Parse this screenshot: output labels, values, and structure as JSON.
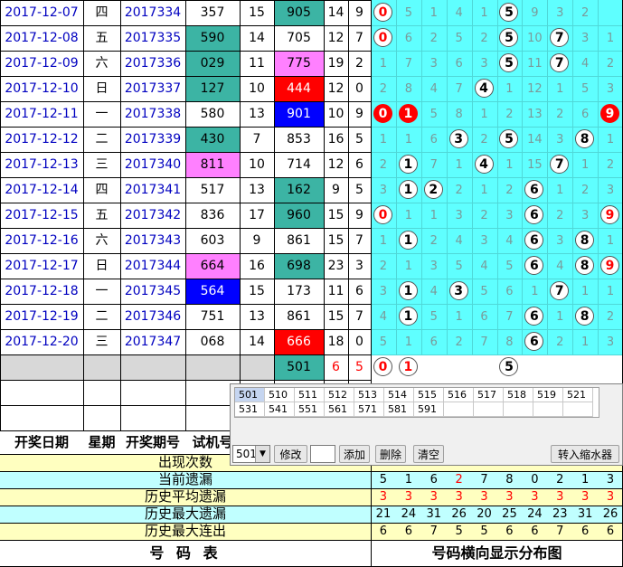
{
  "rows": [
    {
      "date": "2017-12-07",
      "weekday": "四",
      "issue": "2017334",
      "trial": "357",
      "trial_span": "15",
      "prize": "905",
      "prize_sum": "14",
      "prize_span": "9"
    },
    {
      "date": "2017-12-08",
      "weekday": "五",
      "issue": "2017335",
      "trial": "590",
      "trial_span": "14",
      "prize": "705",
      "prize_sum": "12",
      "prize_span": "7"
    },
    {
      "date": "2017-12-09",
      "weekday": "六",
      "issue": "2017336",
      "trial": "029",
      "trial_span": "11",
      "prize": "775",
      "prize_sum": "19",
      "prize_span": "2"
    },
    {
      "date": "2017-12-10",
      "weekday": "日",
      "issue": "2017337",
      "trial": "127",
      "trial_span": "10",
      "prize": "444",
      "prize_sum": "12",
      "prize_span": "0"
    },
    {
      "date": "2017-12-11",
      "weekday": "一",
      "issue": "2017338",
      "trial": "580",
      "trial_span": "13",
      "prize": "901",
      "prize_sum": "10",
      "prize_span": "9"
    },
    {
      "date": "2017-12-12",
      "weekday": "二",
      "issue": "2017339",
      "trial": "430",
      "trial_span": "7",
      "prize": "853",
      "prize_sum": "16",
      "prize_span": "5"
    },
    {
      "date": "2017-12-13",
      "weekday": "三",
      "issue": "2017340",
      "trial": "811",
      "trial_span": "10",
      "prize": "714",
      "prize_sum": "12",
      "prize_span": "6"
    },
    {
      "date": "2017-12-14",
      "weekday": "四",
      "issue": "2017341",
      "trial": "517",
      "trial_span": "13",
      "prize": "162",
      "prize_sum": "9",
      "prize_span": "5"
    },
    {
      "date": "2017-12-15",
      "weekday": "五",
      "issue": "2017342",
      "trial": "836",
      "trial_span": "17",
      "prize": "960",
      "prize_sum": "15",
      "prize_span": "9"
    },
    {
      "date": "2017-12-16",
      "weekday": "六",
      "issue": "2017343",
      "trial": "603",
      "trial_span": "9",
      "prize": "861",
      "prize_sum": "15",
      "prize_span": "7"
    },
    {
      "date": "2017-12-17",
      "weekday": "日",
      "issue": "2017344",
      "trial": "664",
      "trial_span": "16",
      "prize": "698",
      "prize_sum": "23",
      "prize_span": "3"
    },
    {
      "date": "2017-12-18",
      "weekday": "一",
      "issue": "2017345",
      "trial": "564",
      "trial_span": "15",
      "prize": "173",
      "prize_sum": "11",
      "prize_span": "6"
    },
    {
      "date": "2017-12-19",
      "weekday": "二",
      "issue": "2017346",
      "trial": "751",
      "trial_span": "13",
      "prize": "861",
      "prize_sum": "15",
      "prize_span": "7"
    },
    {
      "date": "2017-12-20",
      "weekday": "三",
      "issue": "2017347",
      "trial": "068",
      "trial_span": "14",
      "prize": "666",
      "prize_sum": "18",
      "prize_span": "0"
    }
  ],
  "dist_rows": [
    {
      "balls": [
        0,
        5
      ],
      "miss": {
        "1": "5",
        "2": "1",
        "3": "4",
        "4": "1",
        "6": "9",
        "7": "3",
        "8": "2"
      }
    },
    {
      "balls": [
        0,
        5,
        7
      ],
      "miss": {
        "1": "6",
        "2": "2",
        "3": "5",
        "4": "2",
        "6": "10",
        "8": "3",
        "9": "1"
      }
    },
    {
      "balls": [
        5,
        7
      ],
      "miss": {
        "0": "1",
        "1": "7",
        "2": "3",
        "3": "6",
        "4": "3",
        "6": "11",
        "8": "4",
        "9": "2"
      }
    },
    {
      "balls": [
        4
      ],
      "miss": {
        "0": "2",
        "1": "8",
        "2": "4",
        "3": "7",
        "5": "1",
        "6": "12",
        "7": "1",
        "8": "5",
        "9": "3"
      }
    },
    {
      "balls": [
        0,
        1,
        9
      ],
      "red": [
        0,
        1,
        9
      ],
      "miss": {
        "2": "5",
        "3": "8",
        "4": "1",
        "5": "2",
        "6": "13",
        "7": "2",
        "8": "6"
      }
    },
    {
      "balls": [
        3,
        5,
        8
      ],
      "miss": {
        "0": "1",
        "1": "1",
        "2": "6",
        "4": "2",
        "6": "14",
        "7": "3",
        "9": "1"
      }
    },
    {
      "balls": [
        1,
        4,
        7
      ],
      "miss": {
        "0": "2",
        "2": "7",
        "3": "1",
        "5": "1",
        "6": "15",
        "8": "1",
        "9": "2"
      }
    },
    {
      "balls": [
        1,
        2,
        6
      ],
      "miss": {
        "0": "3",
        "3": "2",
        "4": "1",
        "5": "2",
        "7": "1",
        "8": "2",
        "9": "3"
      }
    },
    {
      "balls": [
        0,
        6,
        9
      ],
      "miss": {
        "1": "1",
        "2": "1",
        "3": "3",
        "4": "2",
        "5": "3",
        "7": "2",
        "8": "3"
      }
    },
    {
      "balls": [
        1,
        6,
        8
      ],
      "miss": {
        "0": "1",
        "2": "2",
        "3": "4",
        "4": "3",
        "5": "4",
        "7": "3",
        "9": "1"
      }
    },
    {
      "balls": [
        6,
        8,
        9
      ],
      "miss": {
        "0": "2",
        "1": "1",
        "2": "3",
        "3": "5",
        "4": "4",
        "5": "5",
        "7": "4"
      }
    },
    {
      "balls": [
        1,
        3,
        7
      ],
      "miss": {
        "0": "3",
        "2": "4",
        "4": "5",
        "5": "6",
        "6": "1",
        "8": "1",
        "9": "1"
      }
    },
    {
      "balls": [
        1,
        6,
        8
      ],
      "miss": {
        "0": "4",
        "2": "5",
        "3": "1",
        "4": "6",
        "5": "7",
        "7": "1",
        "9": "2"
      }
    },
    {
      "balls": [
        6
      ],
      "miss": {
        "0": "5",
        "1": "1",
        "2": "6",
        "3": "2",
        "4": "7",
        "5": "8",
        "7": "2",
        "8": "1",
        "9": "3"
      }
    }
  ],
  "summary_row": {
    "prize": "501",
    "prize_sum": "6",
    "prize_span": "5",
    "balls": [
      0,
      1,
      5
    ]
  },
  "headers": {
    "date": "开奖日期",
    "weekday": "星期",
    "issue": "开奖期号",
    "trial": "试机号"
  },
  "stats": {
    "labels": [
      "出现次数",
      "当前遗漏",
      "历史平均遗漏",
      "历史最大遗漏",
      "历史最大连出"
    ],
    "current_miss": [
      "5",
      "1",
      "6",
      "2",
      "7",
      "8",
      "0",
      "2",
      "1",
      "3"
    ],
    "avg_miss": [
      "3",
      "3",
      "3",
      "3",
      "3",
      "3",
      "3",
      "3",
      "3",
      "3"
    ],
    "max_miss": [
      "21",
      "24",
      "31",
      "26",
      "20",
      "25",
      "24",
      "23",
      "31",
      "26"
    ],
    "max_streak": [
      "6",
      "6",
      "7",
      "5",
      "5",
      "6",
      "6",
      "7",
      "6",
      "6"
    ]
  },
  "footer": {
    "left": "号 码 表",
    "right": "号码横向显示分布图"
  },
  "popup": {
    "grid": [
      [
        "501",
        "510",
        "511",
        "512",
        "513",
        "514",
        "515",
        "516",
        "517",
        "518",
        "519",
        "521"
      ],
      [
        "531",
        "541",
        "551",
        "561",
        "571",
        "581",
        "591",
        "",
        "",
        "",
        "",
        ""
      ]
    ],
    "selected_value": "501",
    "edit_label": "修改",
    "add_label": "添加",
    "delete_label": "删除",
    "clear_label": "清空",
    "transfer_label": "转入缩水器"
  },
  "colors": {
    "teal": "#3cb4a4",
    "pink": "#ff80ff",
    "red": "#ff0000",
    "blue": "#0000ff",
    "grid_bg": "#5fffff",
    "date_color": "#0000c0"
  }
}
